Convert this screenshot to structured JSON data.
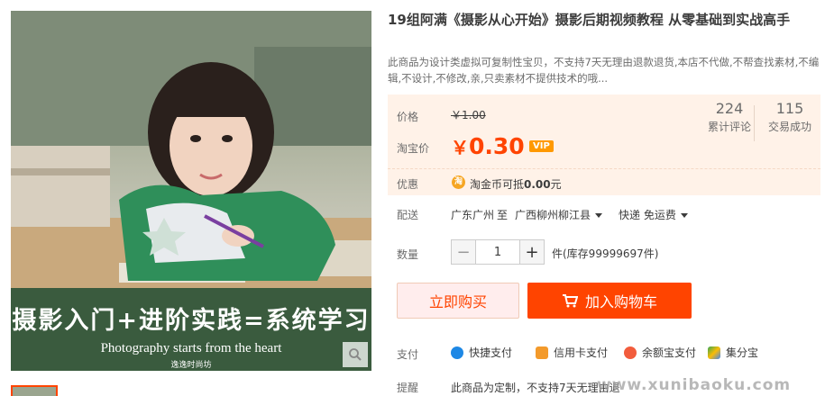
{
  "product": {
    "title": "19组阿满《摄影从心开始》摄影后期视频教程 从零基础到实战高手",
    "subtitle": "此商品为设计类虚拟可复制性宝贝，不支持7天无理由退款退货,本店不代做,不帮查找素材,不编辑,不设计,不修改,亲,只卖素材不提供技术的哦..."
  },
  "image": {
    "banner_line1": "摄影入门+进阶实践=系统学习",
    "banner_line2": "Photography starts from the heart",
    "banner_mark": "逸逸时尚坊"
  },
  "price": {
    "label": "价格",
    "original": "￥1.00",
    "tb_label": "淘宝价",
    "yen": "￥",
    "value": "0.30",
    "vip": "VIP"
  },
  "stats": {
    "reviews_count": "224",
    "reviews_label": "累计评论",
    "sales_count": "115",
    "sales_label": "交易成功"
  },
  "coupon": {
    "label": "优惠",
    "coin_icon": "淘",
    "text_prefix": "淘金币可抵",
    "amount": "0.00",
    "text_suffix": "元"
  },
  "shipping": {
    "label": "配送",
    "from": "广东广州",
    "to_word": "至",
    "destination": "广西柳州柳江县",
    "method": "快递 免运费"
  },
  "quantity": {
    "label": "数量",
    "value": "1",
    "minus": "−",
    "plus": "+",
    "stock": "件(库存99999697件)"
  },
  "actions": {
    "buy_now": "立即购买",
    "add_to_cart": "加入购物车"
  },
  "payment": {
    "label": "支付",
    "methods": [
      "快捷支付",
      "信用卡支付",
      "余额宝支付",
      "集分宝"
    ]
  },
  "reminder": {
    "label": "提醒",
    "text": "此商品为定制，不支持7天无理由退"
  },
  "watermark": "www.xunibaoku.com",
  "colors": {
    "accent": "#ff4400",
    "price_bg": "#fff2e8",
    "banner_bg": "#3a5b3e",
    "vip": "#ff9900"
  }
}
